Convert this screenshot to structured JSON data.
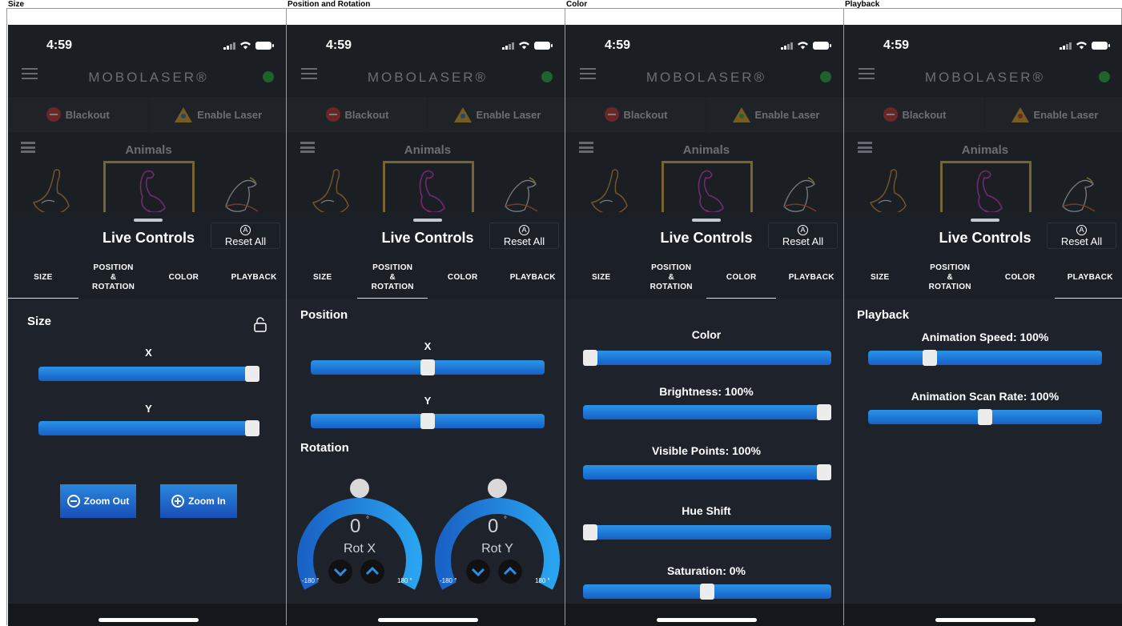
{
  "columns": [
    {
      "title": "Size"
    },
    {
      "title": "Position and Rotation"
    },
    {
      "title": "Color"
    },
    {
      "title": "Playback"
    }
  ],
  "status": {
    "time": "4:59"
  },
  "app": {
    "brand": "MOBOLASER®",
    "blackout": "Blackout",
    "enable_laser": "Enable Laser",
    "category": "Animals",
    "thumbnails": [
      "ostrich",
      "flamingo",
      "eagle"
    ]
  },
  "sheet": {
    "title": "Live Controls",
    "reset": "Reset All",
    "tabs": [
      "SIZE",
      "POSITION & ROTATION",
      "COLOR",
      "PLAYBACK"
    ]
  },
  "size_panel": {
    "title": "Size",
    "x_label": "X",
    "x_value": 1.0,
    "y_label": "Y",
    "y_value": 1.0,
    "zoom_out": "Zoom Out",
    "zoom_in": "Zoom In"
  },
  "position_panel": {
    "position_title": "Position",
    "x_label": "X",
    "x_value": 0.5,
    "y_label": "Y",
    "y_value": 0.5,
    "rotation_title": "Rotation",
    "rot_x": {
      "value": "0",
      "unit": "°",
      "label": "Rot X",
      "min": "-180 °",
      "max": "180 °"
    },
    "rot_y": {
      "value": "0",
      "unit": "°",
      "label": "Rot Y",
      "min": "-180 °",
      "max": "180 °"
    }
  },
  "color_panel": {
    "color_label": "Color",
    "color_value": 0.0,
    "brightness_label": "Brightness: 100%",
    "brightness_value": 1.0,
    "visible_points_label": "Visible Points: 100%",
    "visible_points_value": 1.0,
    "hue_shift_label": "Hue Shift",
    "hue_shift_value": 0.0,
    "saturation_label": "Saturation: 0%",
    "saturation_value": 0.5
  },
  "playback_panel": {
    "title": "Playback",
    "speed_label": "Animation Speed: 100%",
    "speed_value": 0.25,
    "scan_label": "Animation Scan Rate: 100%",
    "scan_value": 0.5
  },
  "colors": {
    "accent_blue": "#1e7fdc",
    "led_green": "#23c33c",
    "blackout_red": "#d9342b",
    "warning_yellow": "#f1b320",
    "selection_gold": "#f3c74a"
  }
}
